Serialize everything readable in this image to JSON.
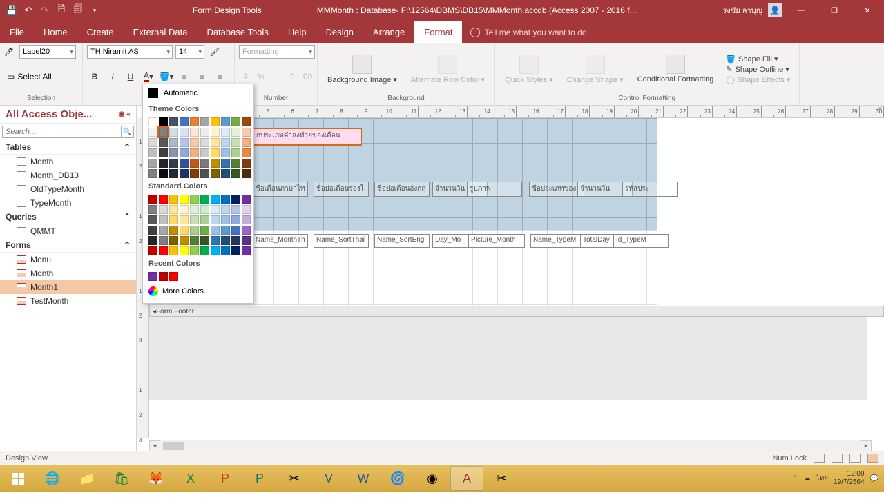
{
  "titlebar": {
    "tools_label": "Form Design Tools",
    "doc_title": "MMMonth : Database- F:\\12564\\DBMS\\DB15\\MMMonth.accdb (Access 2007 - 2016 f...",
    "user": "รงชัย ลาบุญ"
  },
  "menu": {
    "file": "File",
    "home": "Home",
    "create": "Create",
    "external": "External Data",
    "dbtools": "Database Tools",
    "help": "Help",
    "design": "Design",
    "arrange": "Arrange",
    "format": "Format",
    "tellme": "Tell me what you want to do"
  },
  "ribbon": {
    "selection_ctl": "Label20",
    "select_all": "Select All",
    "group_selection": "Selection",
    "font_name": "TH Niramit AS",
    "font_size": "14",
    "formatting": "Formatting",
    "group_number": "Number",
    "bg_image": "Background Image ▾",
    "alt_row": "Alternate Row Color ▾",
    "group_background": "Background",
    "quick_styles": "Quick Styles ▾",
    "change_shape": "Change Shape ▾",
    "cond_fmt": "Conditional Formatting",
    "shape_fill": "Shape Fill ▾",
    "shape_outline": "Shape Outline ▾",
    "shape_effects": "Shape Effects ▾",
    "group_ctrlfmt": "Control Formatting"
  },
  "colorpicker": {
    "automatic": "Automatic",
    "theme": "Theme Colors",
    "standard": "Standard Colors",
    "recent": "Recent Colors",
    "more": "More Colors...",
    "theme_row": [
      "#ffffff",
      "#000000",
      "#44546a",
      "#4472c4",
      "#ed7d31",
      "#a5a5a5",
      "#ffc000",
      "#5b9bd5",
      "#70ad47",
      "#9e480e"
    ],
    "theme_tints": [
      [
        "#f2f2f2",
        "#808080",
        "#d6dce5",
        "#d9e1f2",
        "#fce4d6",
        "#ededed",
        "#fff2cc",
        "#ddebf7",
        "#e2efda",
        "#f8cbad"
      ],
      [
        "#d9d9d9",
        "#595959",
        "#acb9ca",
        "#b4c6e7",
        "#f8cbad",
        "#dbdbdb",
        "#ffe699",
        "#bdd7ee",
        "#c6e0b4",
        "#f4b084"
      ],
      [
        "#bfbfbf",
        "#404040",
        "#8497b0",
        "#8ea9db",
        "#f4b084",
        "#c9c9c9",
        "#ffd966",
        "#9bc2e6",
        "#a9d08e",
        "#e38c47"
      ],
      [
        "#a6a6a6",
        "#262626",
        "#333f4f",
        "#305496",
        "#c65911",
        "#7b7b7b",
        "#bf8f00",
        "#2f75b5",
        "#548235",
        "#833c0c"
      ],
      [
        "#808080",
        "#0d0d0d",
        "#222b35",
        "#203764",
        "#833c0c",
        "#525252",
        "#806000",
        "#1f4e78",
        "#375623",
        "#4f2d0b"
      ]
    ],
    "standard_row": [
      "#c00000",
      "#ff0000",
      "#ffc000",
      "#ffff00",
      "#92d050",
      "#00b050",
      "#00b0f0",
      "#0070c0",
      "#002060",
      "#7030a0"
    ],
    "standard_tints": [
      [
        "#7f7f7f",
        "#d9d9d9",
        "#ffe699",
        "#fff2cc",
        "#e2efda",
        "#c6efce",
        "#ddebf7",
        "#bdd7ee",
        "#b4c6e7",
        "#e1d5ec"
      ],
      [
        "#595959",
        "#bfbfbf",
        "#ffd966",
        "#ffe699",
        "#c6e0b4",
        "#a9d08e",
        "#bdd7ee",
        "#9bc2e6",
        "#8ea9db",
        "#c5aed8"
      ],
      [
        "#404040",
        "#a6a6a6",
        "#bf8f00",
        "#ffd966",
        "#a9d08e",
        "#70ad47",
        "#9bc2e6",
        "#5b9bd5",
        "#4472c4",
        "#9966cc"
      ],
      [
        "#262626",
        "#808080",
        "#806000",
        "#bf8f00",
        "#548235",
        "#385723",
        "#2f75b5",
        "#1f4e78",
        "#203764",
        "#5a3286"
      ],
      [
        "#c00000",
        "#ff0000",
        "#ffc000",
        "#ffff00",
        "#92d050",
        "#00b050",
        "#00b0f0",
        "#0070c0",
        "#002060",
        "#7030a0"
      ]
    ],
    "recent_row": [
      "#7030a0",
      "#c00000",
      "#ff0000"
    ]
  },
  "nav": {
    "header": "All Access Obje...",
    "search_ph": "Search...",
    "tables": "Tables",
    "table_items": [
      "Month",
      "Month_DB13",
      "OldTypeMonth",
      "TypeMonth"
    ],
    "queries": "Queries",
    "query_items": [
      "QMMT"
    ],
    "forms": "Forms",
    "form_items": [
      "Menu",
      "Month",
      "Month1",
      "TestMonth"
    ],
    "selected_form": "Month1"
  },
  "design": {
    "sel_label": "กประเภทคำลงท้ายของเดือน",
    "header_labels": [
      "ชื่อเดือนภาษาไท",
      "ชื่อย่อเดือนรองไ",
      "ชื่อย่อเดือนอังกฤ",
      "จำนวนวัน",
      "รูปภาพ",
      "ชื่อประเภทของ",
      "จำนวนวัน",
      "รหัสประ"
    ],
    "detail_fields": [
      "Name_MonthTh",
      "Name_SortThai",
      "Name_SortEng",
      "Day_Mo",
      "Picture_Month",
      "Name_TypeM",
      "TotalDay",
      "Id_TypeM"
    ],
    "footer": "Form Footer"
  },
  "status": {
    "left": "Design View",
    "numlock": "Num Lock"
  },
  "taskbar": {
    "lang": "ไทย",
    "time": "12:09",
    "date": "19/7/2564"
  }
}
